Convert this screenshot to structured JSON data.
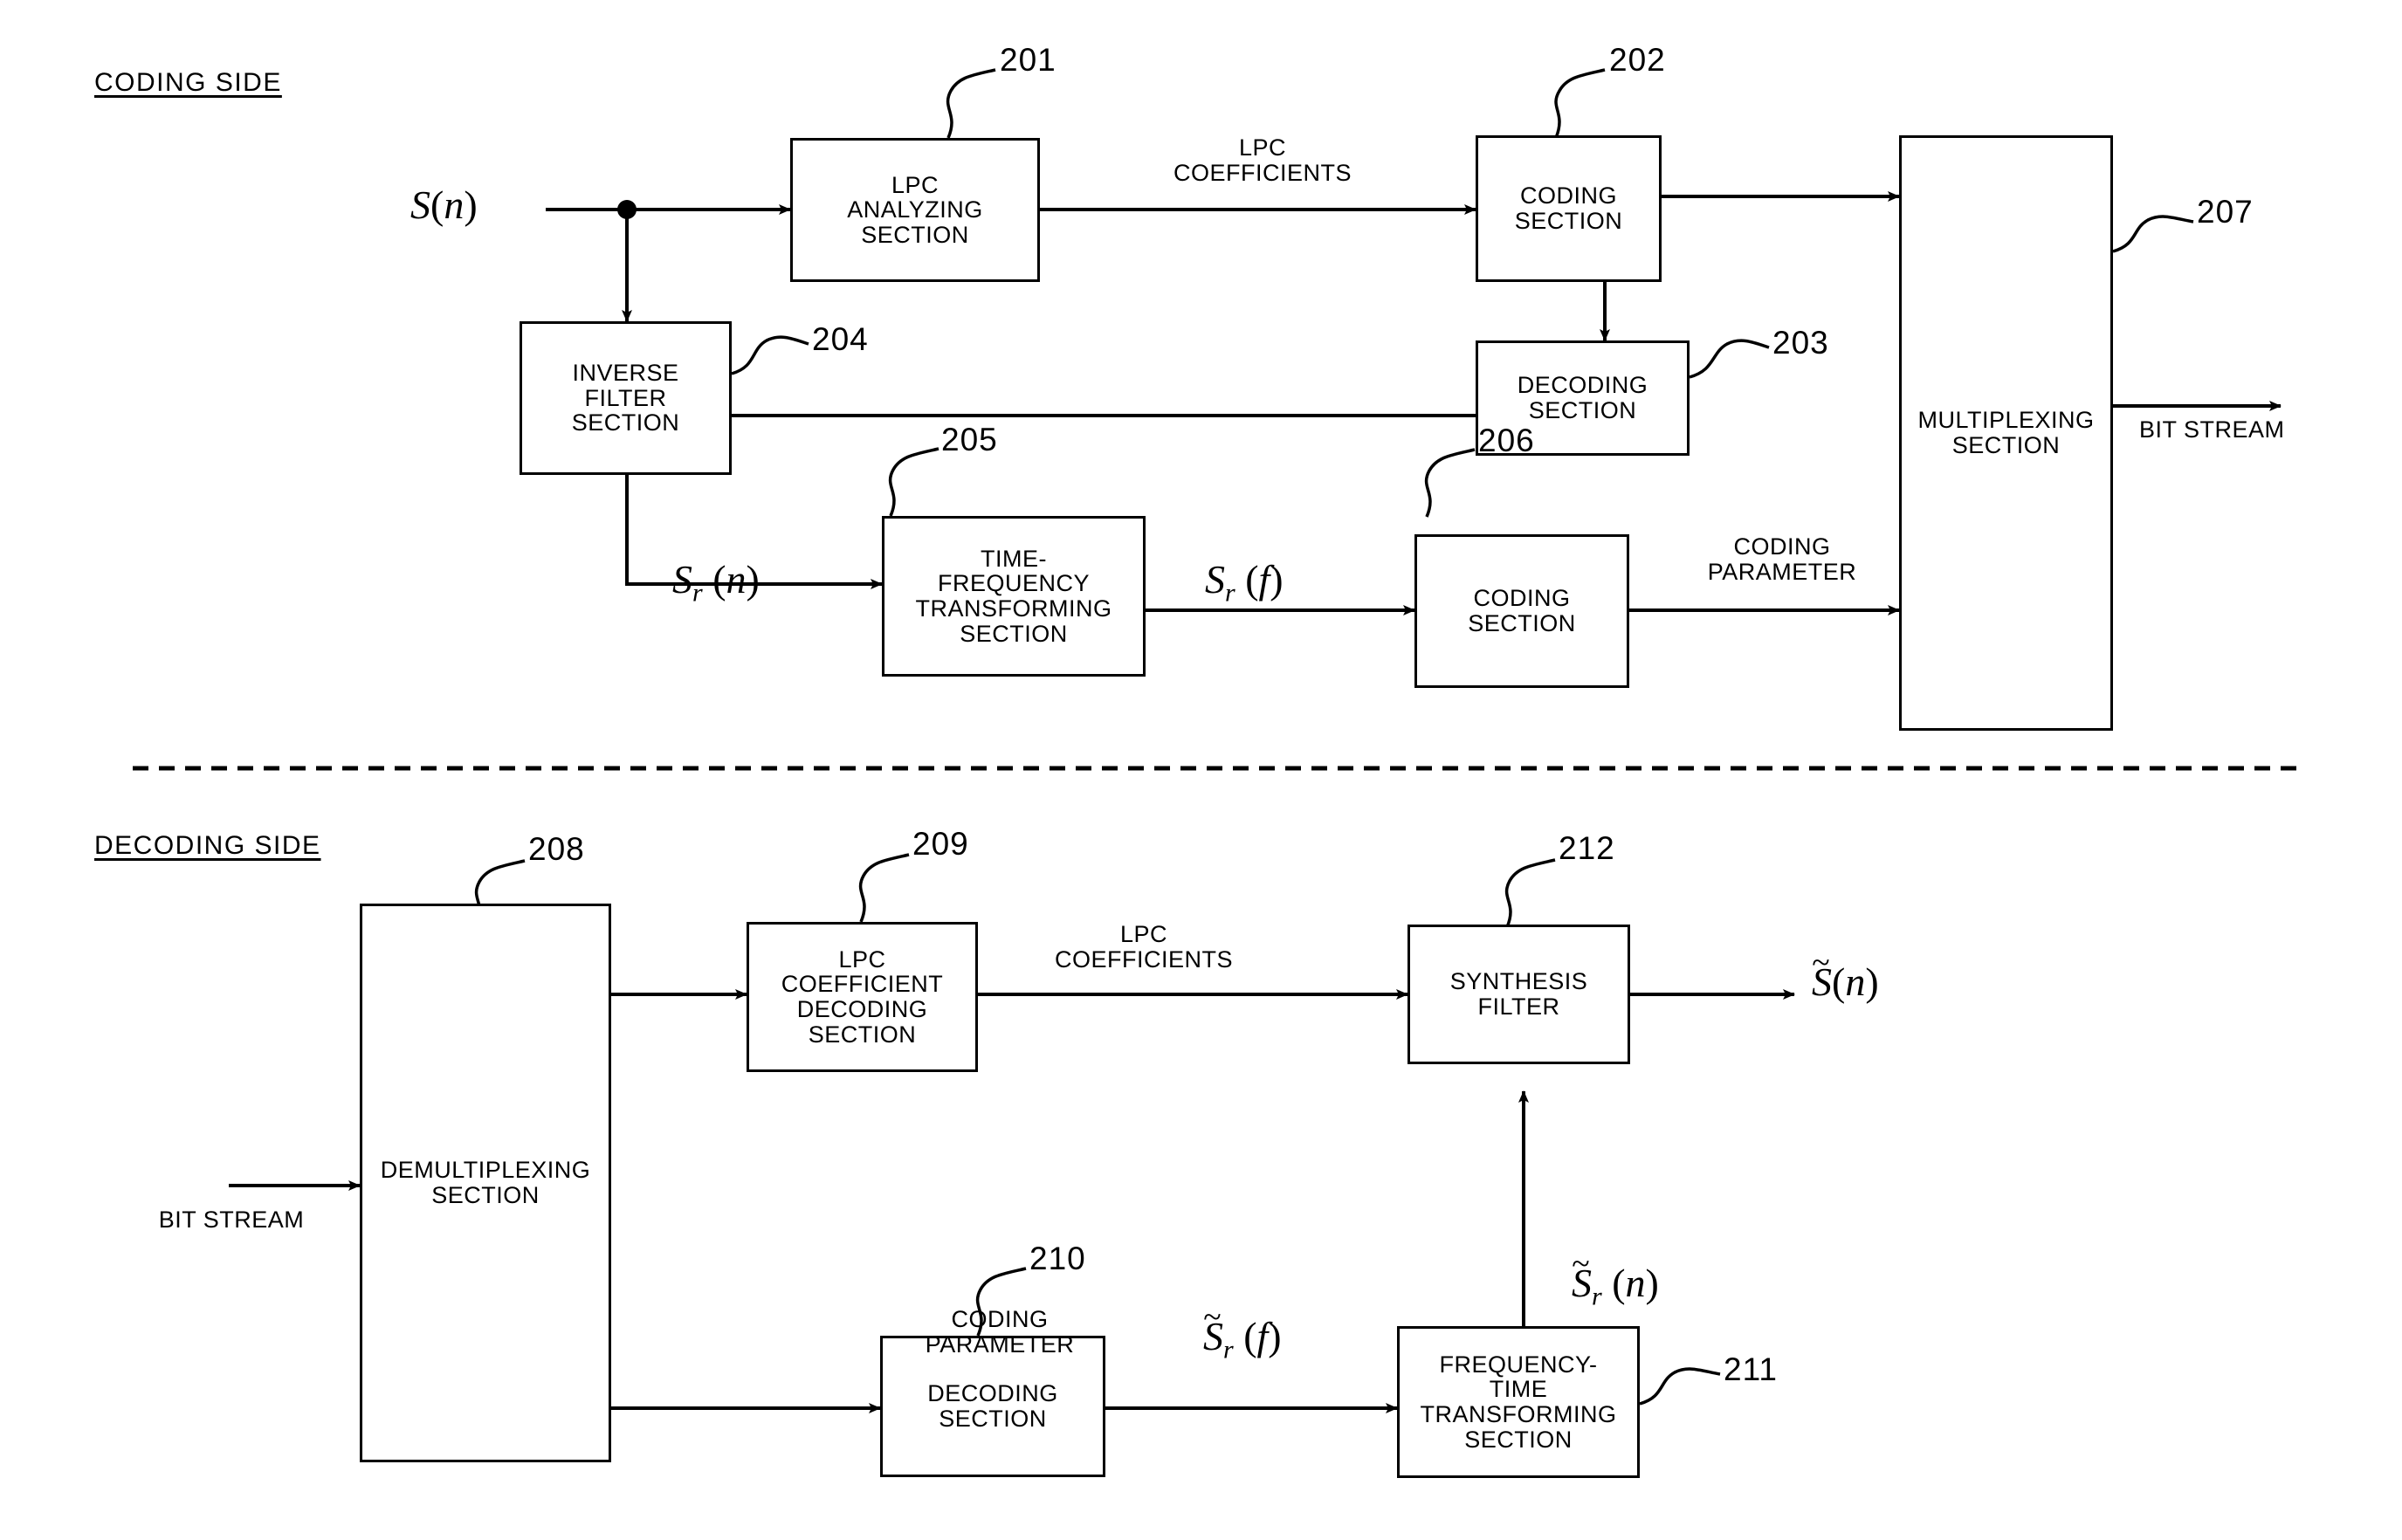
{
  "figure": {
    "coding_side_title": "CODING SIDE",
    "decoding_side_title": "DECODING SIDE"
  },
  "coding_side": {
    "blocks": [
      {
        "id": "201",
        "label": "LPC\nANALYZING\nSECTION",
        "ref": "201"
      },
      {
        "id": "202",
        "label": "CODING\nSECTION",
        "ref": "202"
      },
      {
        "id": "203",
        "label": "DECODING\nSECTION",
        "ref": "203"
      },
      {
        "id": "204",
        "label": "INVERSE\nFILTER\nSECTION",
        "ref": "204"
      },
      {
        "id": "205",
        "label": "TIME-\nFREQUENCY\nTRANSFORMING\nSECTION",
        "ref": "205"
      },
      {
        "id": "206",
        "label": "CODING\nSECTION",
        "ref": "206"
      },
      {
        "id": "207",
        "label": "MULTIPLEXING\nSECTION",
        "ref": "207"
      }
    ],
    "signals": {
      "input": "S(n)",
      "input_sub": "",
      "lpc_coefficients": "LPC\nCOEFFICIENTS",
      "residual_time": "S_r(n)",
      "residual_freq": "S_r(f)",
      "coding_parameter": "CODING\nPARAMETER",
      "bit_stream_out": "BIT STREAM"
    }
  },
  "decoding_side": {
    "blocks": [
      {
        "id": "208",
        "label": "DEMULTIPLEXING\nSECTION",
        "ref": "208"
      },
      {
        "id": "209",
        "label": "LPC\nCOEFFICIENT\nDECODING\nSECTION",
        "ref": "209"
      },
      {
        "id": "210",
        "label": "DECODING\nSECTION",
        "ref": "210"
      },
      {
        "id": "211",
        "label": "FREQUENCY-\nTIME\nTRANSFORMING\nSECTION",
        "ref": "211"
      },
      {
        "id": "212",
        "label": "SYNTHESIS\nFILTER",
        "ref": "212"
      }
    ],
    "signals": {
      "bit_stream_in": "BIT STREAM",
      "lpc_coefficients": "LPC\nCOEFFICIENTS",
      "coding_parameter": "CODING\nPARAMETER",
      "decoded_freq": "S~_r(f)",
      "decoded_time": "S~_r(n)",
      "output": "S~(n)"
    }
  },
  "colors": {
    "line": "#000000",
    "background": "#ffffff"
  }
}
